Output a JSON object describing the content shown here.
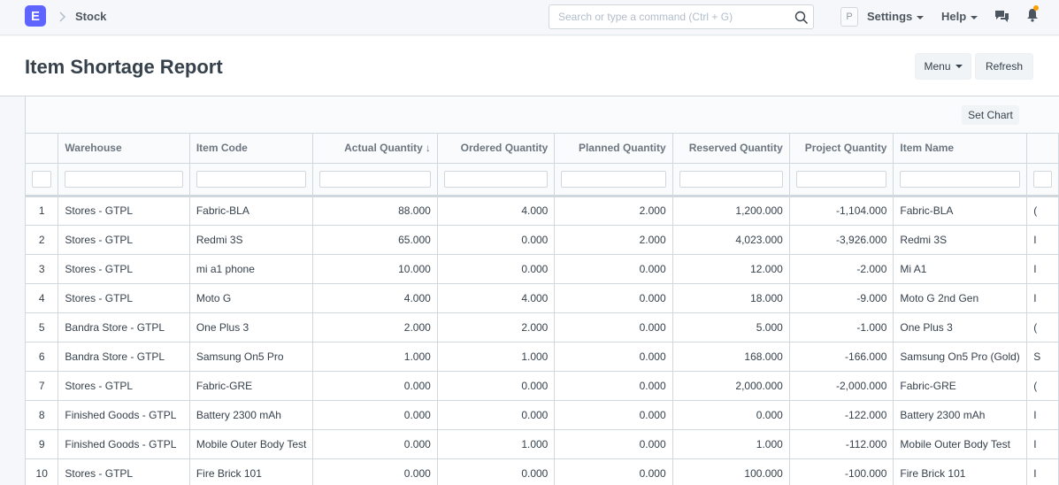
{
  "navbar": {
    "logo_letter": "E",
    "breadcrumb": "Stock",
    "search_placeholder": "Search or type a command (Ctrl + G)",
    "avatar_letter": "P",
    "settings_label": "Settings",
    "help_label": "Help"
  },
  "page": {
    "title": "Item Shortage Report",
    "menu_label": "Menu",
    "refresh_label": "Refresh",
    "set_chart_label": "Set Chart"
  },
  "colors": {
    "accent": "#5e64ff",
    "notification": "#ff9e00"
  },
  "table": {
    "columns": [
      "Warehouse",
      "Item Code",
      "Actual Quantity",
      "Ordered Quantity",
      "Planned Quantity",
      "Reserved Quantity",
      "Project Quantity",
      "Item Name"
    ],
    "sort_indicator": "↓",
    "rows": [
      {
        "idx": "1",
        "warehouse": "Stores - GTPL",
        "item_code": "Fabric-BLA",
        "actual": "88.000",
        "ordered": "4.000",
        "planned": "2.000",
        "reserved": "1,200.000",
        "projected": "-1,104.000",
        "item_name": "Fabric-BLA",
        "extra": "("
      },
      {
        "idx": "2",
        "warehouse": "Stores - GTPL",
        "item_code": "Redmi 3S",
        "actual": "65.000",
        "ordered": "0.000",
        "planned": "2.000",
        "reserved": "4,023.000",
        "projected": "-3,926.000",
        "item_name": "Redmi 3S",
        "extra": "I"
      },
      {
        "idx": "3",
        "warehouse": "Stores - GTPL",
        "item_code": "mi a1 phone",
        "actual": "10.000",
        "ordered": "0.000",
        "planned": "0.000",
        "reserved": "12.000",
        "projected": "-2.000",
        "item_name": "Mi A1",
        "extra": "I"
      },
      {
        "idx": "4",
        "warehouse": "Stores - GTPL",
        "item_code": "Moto G",
        "actual": "4.000",
        "ordered": "4.000",
        "planned": "0.000",
        "reserved": "18.000",
        "projected": "-9.000",
        "item_name": "Moto G 2nd Gen",
        "extra": "I"
      },
      {
        "idx": "5",
        "warehouse": "Bandra Store - GTPL",
        "item_code": "One Plus 3",
        "actual": "2.000",
        "ordered": "2.000",
        "planned": "0.000",
        "reserved": "5.000",
        "projected": "-1.000",
        "item_name": "One Plus 3",
        "extra": "("
      },
      {
        "idx": "6",
        "warehouse": "Bandra Store - GTPL",
        "item_code": "Samsung On5 Pro",
        "actual": "1.000",
        "ordered": "1.000",
        "planned": "0.000",
        "reserved": "168.000",
        "projected": "-166.000",
        "item_name": "Samsung On5 Pro (Gold)",
        "extra": "S"
      },
      {
        "idx": "7",
        "warehouse": "Stores - GTPL",
        "item_code": "Fabric-GRE",
        "actual": "0.000",
        "ordered": "0.000",
        "planned": "0.000",
        "reserved": "2,000.000",
        "projected": "-2,000.000",
        "item_name": "Fabric-GRE",
        "extra": "("
      },
      {
        "idx": "8",
        "warehouse": "Finished Goods - GTPL",
        "item_code": "Battery 2300 mAh",
        "actual": "0.000",
        "ordered": "0.000",
        "planned": "0.000",
        "reserved": "0.000",
        "projected": "-122.000",
        "item_name": "Battery 2300 mAh",
        "extra": "I"
      },
      {
        "idx": "9",
        "warehouse": "Finished Goods - GTPL",
        "item_code": "Mobile Outer Body Test",
        "actual": "0.000",
        "ordered": "1.000",
        "planned": "0.000",
        "reserved": "1.000",
        "projected": "-112.000",
        "item_name": "Mobile Outer Body Test",
        "extra": "I"
      },
      {
        "idx": "10",
        "warehouse": "Stores - GTPL",
        "item_code": "Fire Brick 101",
        "actual": "0.000",
        "ordered": "0.000",
        "planned": "0.000",
        "reserved": "100.000",
        "projected": "-100.000",
        "item_name": "Fire Brick 101",
        "extra": "I"
      }
    ]
  }
}
